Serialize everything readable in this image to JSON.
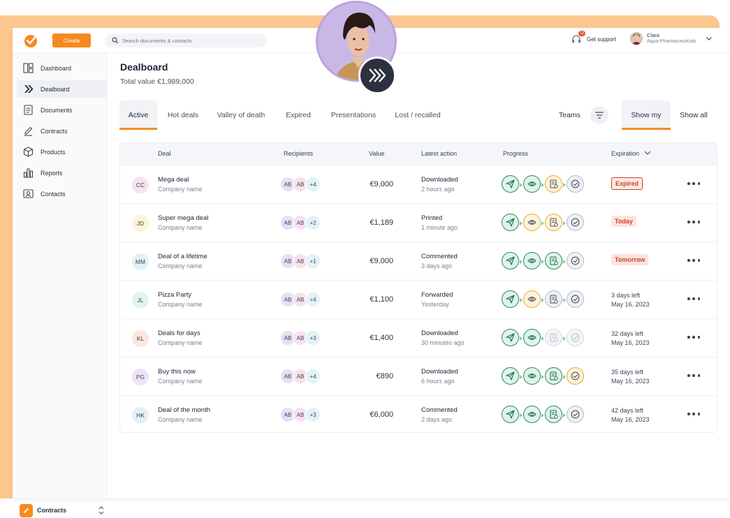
{
  "brand_color": "#f68a1f",
  "topbar": {
    "create_label": "Create",
    "search_placeholder": "Search documents & contacts",
    "support_label": "Get support",
    "support_badge": "12",
    "user_name": "Clara",
    "user_org": "Aqua-Pharmaceuticals"
  },
  "sidebar": {
    "items": [
      {
        "label": "Dashboard",
        "icon": "dashboard-icon"
      },
      {
        "label": "Dealboard",
        "icon": "dealboard-icon"
      },
      {
        "label": "Documents",
        "icon": "document-icon"
      },
      {
        "label": "Contracts",
        "icon": "pen-icon"
      },
      {
        "label": "Products",
        "icon": "box-icon"
      },
      {
        "label": "Reports",
        "icon": "bar-chart-icon"
      },
      {
        "label": "Contacts",
        "icon": "contact-card-icon"
      }
    ],
    "workspace_label": "Contracts"
  },
  "main": {
    "title": "Dealboard",
    "total": "Total value €1,989,000",
    "tabs": [
      "Active",
      "Hot deals",
      "Valley of death",
      "Expired",
      "Presentations",
      "Lost / recalled"
    ],
    "teams_label": "Teams",
    "show_my": "Show my",
    "show_all": "Show all"
  },
  "table": {
    "headers": {
      "deal": "Deal",
      "recipients": "Recipients",
      "value": "Value",
      "latest": "Latest action",
      "progress": "Progress",
      "expiration": "Expiration"
    },
    "rows": [
      {
        "initials": "CC",
        "color": "#f7e3ef",
        "name": "Mega deal",
        "company": "Company name",
        "r1": "AB",
        "r2": "AB",
        "more": "+4",
        "value": "€9,000",
        "action": "Downloaded",
        "ago": "2 hours ago",
        "progress": [
          "done",
          "done",
          "warn",
          "idle"
        ],
        "exp_type": "expired",
        "exp1": "Expired",
        "exp2": ""
      },
      {
        "initials": "JD",
        "color": "#fdf3d9",
        "name": "Super mega deal",
        "company": "Company name",
        "r1": "AB",
        "r2": "AB",
        "more": "+2",
        "value": "€1,189",
        "action": "Printed",
        "ago": "1 minute ago",
        "progress": [
          "done",
          "warn",
          "warn",
          "idle"
        ],
        "exp_type": "soon",
        "exp1": "Today",
        "exp2": ""
      },
      {
        "initials": "MM",
        "color": "#e1f1f7",
        "name": "Deal of a lifetime",
        "company": "Company name",
        "r1": "AB",
        "r2": "AB",
        "more": "+1",
        "value": "€9,000",
        "action": "Commented",
        "ago": "3 days ago",
        "progress": [
          "done",
          "done",
          "done",
          "idle"
        ],
        "exp_type": "soon",
        "exp1": "Tomorrow",
        "exp2": ""
      },
      {
        "initials": "JL",
        "color": "#e3f4ea",
        "name": "Pizza Party",
        "company": "Company name",
        "r1": "AB",
        "r2": "AB",
        "more": "+4",
        "value": "€1,100",
        "action": "Forwarded",
        "ago": "Yesterday",
        "progress": [
          "done",
          "warn",
          "idle",
          "idle"
        ],
        "exp_type": "days",
        "exp1": "3 days left",
        "exp2": "May 16, 2023"
      },
      {
        "initials": "KL",
        "color": "#fbe8dc",
        "name": "Deals for days",
        "company": "Company name",
        "r1": "AB",
        "r2": "AB",
        "more": "+3",
        "value": "€1,400",
        "action": "Downloaded",
        "ago": "30 minutes ago",
        "progress": [
          "done",
          "done",
          "faded",
          "faded"
        ],
        "exp_type": "days",
        "exp1": "32 days left",
        "exp2": "May 16, 2023"
      },
      {
        "initials": "PG",
        "color": "#efe4f7",
        "name": "Buy this now",
        "company": "Company name",
        "r1": "AB",
        "r2": "AB",
        "more": "+4",
        "value": "€890",
        "action": "Downloaded",
        "ago": "6 hours ago",
        "progress": [
          "done",
          "done",
          "done",
          "warn"
        ],
        "exp_type": "days",
        "exp1": "35 days left",
        "exp2": "May 16, 2023"
      },
      {
        "initials": "HK",
        "color": "#e1f1f7",
        "name": "Deal of the month",
        "company": "Company name",
        "r1": "AB",
        "r2": "AB",
        "more": "+3",
        "value": "€6,000",
        "action": "Commented",
        "ago": "2 days ago",
        "progress": [
          "done",
          "done",
          "done",
          "idle"
        ],
        "exp_type": "days",
        "exp1": "42 days left",
        "exp2": "May 16, 2023"
      }
    ]
  }
}
